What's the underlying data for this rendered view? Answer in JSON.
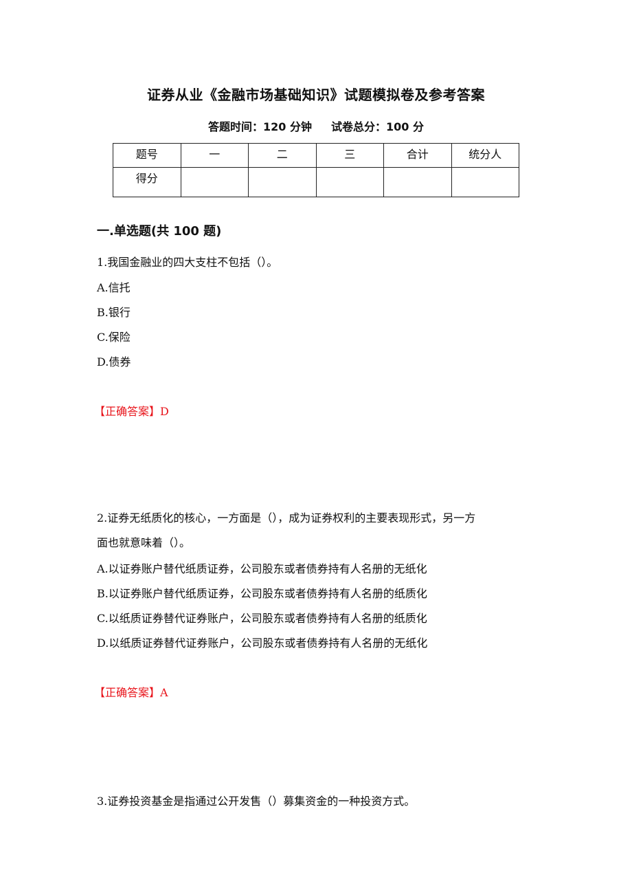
{
  "header": {
    "title": "证券从业《金融市场基础知识》试题模拟卷及参考答案",
    "time_label": "答题时间：120 分钟",
    "score_label": "试卷总分：100 分"
  },
  "score_table": {
    "row1": [
      "题号",
      "一",
      "二",
      "三",
      "合计",
      "统分人"
    ],
    "row2": [
      "得分",
      "",
      "",
      "",
      "",
      ""
    ]
  },
  "section": {
    "title": "一.单选题(共 100 题)"
  },
  "questions": [
    {
      "lines": [
        "1.我国金融业的四大支柱不包括（）。"
      ],
      "options": [
        "A.信托",
        "B.银行",
        "C.保险",
        "D.债券"
      ],
      "answer_label": "【正确答案】",
      "answer": "D"
    },
    {
      "lines": [
        "2.证券无纸质化的核心，一方面是（），成为证券权利的主要表现形式，另一方",
        "面也就意味着（）。"
      ],
      "options": [
        "A.以证券账户替代纸质证券，公司股东或者债券持有人名册的无纸化",
        "B.以证券账户替代纸质证券，公司股东或者债券持有人名册的纸质化",
        "C.以纸质证券替代证券账户，公司股东或者债券持有人名册的纸质化",
        "D.以纸质证券替代证券账户，公司股东或者债券持有人名册的无纸化"
      ],
      "answer_label": "【正确答案】",
      "answer": "A"
    },
    {
      "lines": [
        "3.证券投资基金是指通过公开发售（）募集资金的一种投资方式。"
      ]
    }
  ]
}
